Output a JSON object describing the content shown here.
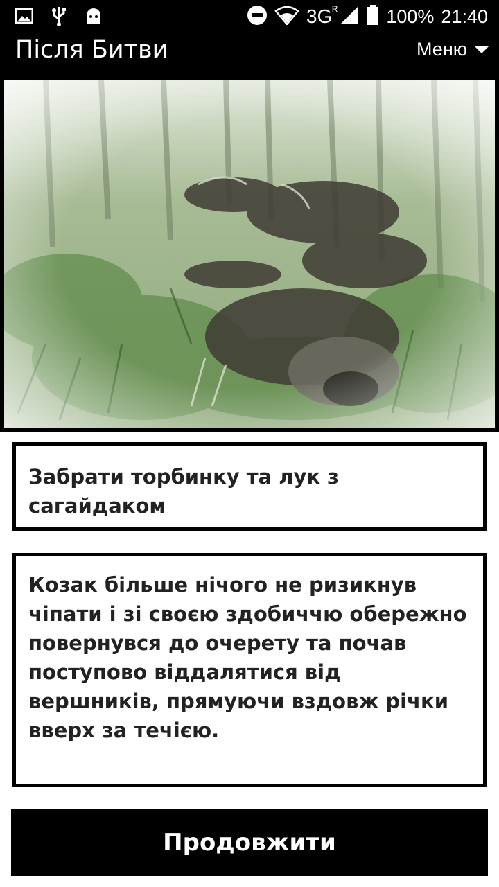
{
  "status_bar": {
    "network": "3G",
    "network_sup": "R",
    "battery": "100%",
    "time": "21:40",
    "icons_left": [
      "image-icon",
      "usb-icon",
      "android-icon"
    ],
    "icons_right": [
      "do-not-disturb-icon",
      "wifi-icon",
      "signal-icon",
      "battery-icon"
    ]
  },
  "app_bar": {
    "title": "Після Битви",
    "menu_label": "Меню"
  },
  "scene": {
    "description_icon": "forest-battlefield-illustration"
  },
  "choice": {
    "text": "Забрати торбинку та лук з сагайдаком"
  },
  "story": {
    "text": "Козак більше нічого не ризикнув чіпати і зі своєю здобиччю обережно повернувся до очерету та почав поступово віддалятися від вершників, прямуючи вздовж річки вверх за течією."
  },
  "actions": {
    "continue_label": "Продовжити"
  },
  "colors": {
    "bar_bg": "#000000",
    "text_dark": "#222222",
    "foliage": "#7d9a6a"
  }
}
